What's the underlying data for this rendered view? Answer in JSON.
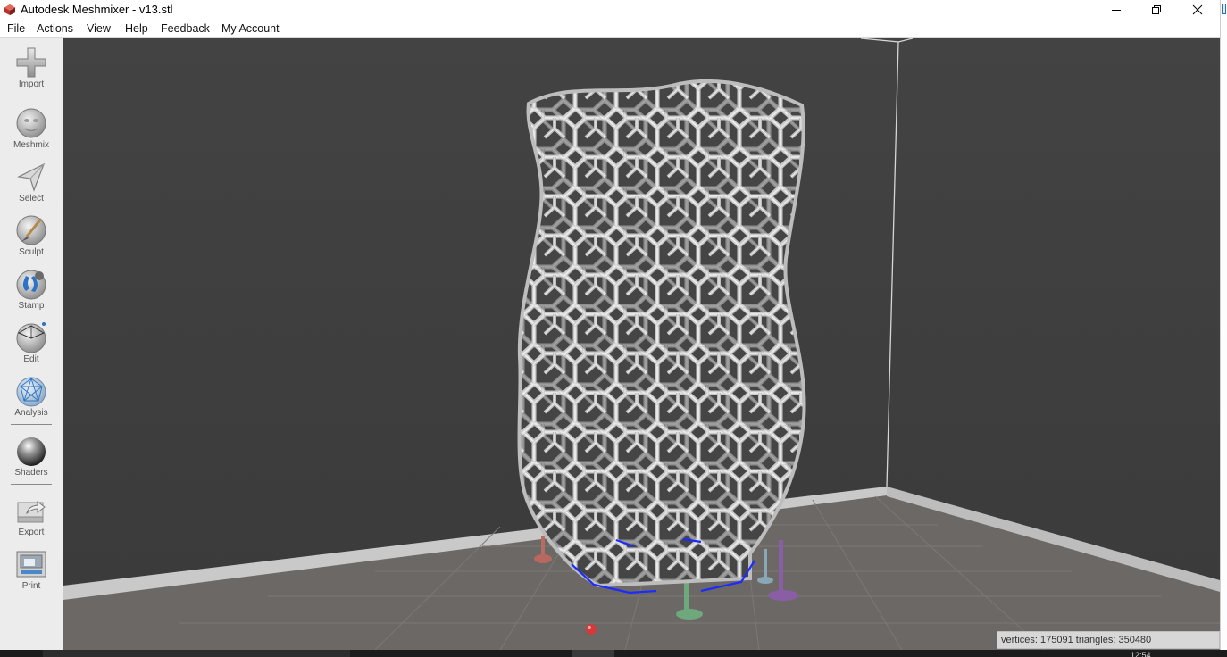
{
  "window": {
    "title": "Autodesk Meshmixer - v13.stl"
  },
  "menu": {
    "items": [
      {
        "id": "file",
        "label": "File"
      },
      {
        "id": "actions",
        "label": "Actions"
      },
      {
        "id": "view",
        "label": "View"
      },
      {
        "id": "help",
        "label": "Help"
      },
      {
        "id": "feedback",
        "label": "Feedback"
      },
      {
        "id": "my-account",
        "label": "My Account"
      }
    ]
  },
  "toolbar": {
    "tools": [
      {
        "id": "import",
        "label": "Import",
        "icon": "plus-icon"
      },
      {
        "id": "meshmix",
        "label": "Meshmix",
        "icon": "bunny-icon"
      },
      {
        "id": "select",
        "label": "Select",
        "icon": "select-arrow-icon"
      },
      {
        "id": "sculpt",
        "label": "Sculpt",
        "icon": "brush-icon"
      },
      {
        "id": "stamp",
        "label": "Stamp",
        "icon": "stamp-icon"
      },
      {
        "id": "edit",
        "label": "Edit",
        "icon": "edit-sphere-icon"
      },
      {
        "id": "analysis",
        "label": "Analysis",
        "icon": "analysis-icon"
      },
      {
        "id": "shaders",
        "label": "Shaders",
        "icon": "shader-sphere-icon"
      },
      {
        "id": "export",
        "label": "Export",
        "icon": "export-icon"
      },
      {
        "id": "print",
        "label": "Print",
        "icon": "printer-icon"
      }
    ]
  },
  "status": {
    "text": "vertices: 175091 triangles: 350480"
  },
  "taskbar": {
    "clock": "12:54"
  },
  "colors": {
    "viewport_background": "#3f3f3f",
    "build_plate": "#6d6a67",
    "mesh": "#cfcfcf",
    "support_outline": "#1d2bff"
  }
}
